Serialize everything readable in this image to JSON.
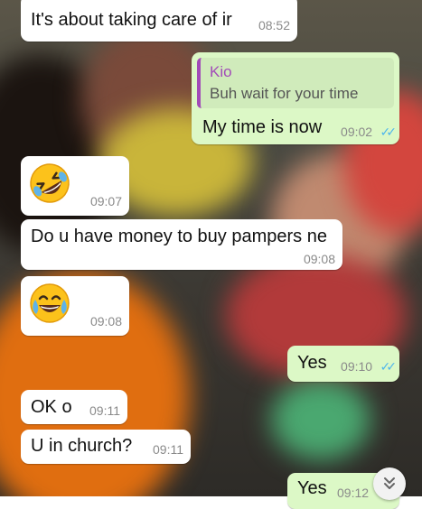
{
  "messages": [
    {
      "text": "It's about taking care of ir",
      "time": "08:52"
    },
    {
      "quote_author": "Kio",
      "quote_text": "Buh wait for your time",
      "text": "My time is now",
      "time": "09:02"
    },
    {
      "emoji": "rolling-on-floor-laughing-emoji",
      "time": "09:07"
    },
    {
      "text": "Do u have money to buy pampers ne",
      "time": "09:08"
    },
    {
      "emoji": "face-with-tears-of-joy-emoji",
      "time": "09:08"
    },
    {
      "text": "Yes",
      "time": "09:10"
    },
    {
      "text": "OK o",
      "time": "09:11"
    },
    {
      "text": "U in church?",
      "time": "09:11"
    },
    {
      "text": "Yes",
      "time": "09:12"
    }
  ],
  "colors": {
    "incoming_bubble": "#ffffff",
    "outgoing_bubble": "#dcf8c6",
    "read_ticks": "#4fb6ec",
    "quote_accent": "#a24bb8"
  },
  "scroll_button": {
    "icon": "chevron-double-down-icon"
  }
}
